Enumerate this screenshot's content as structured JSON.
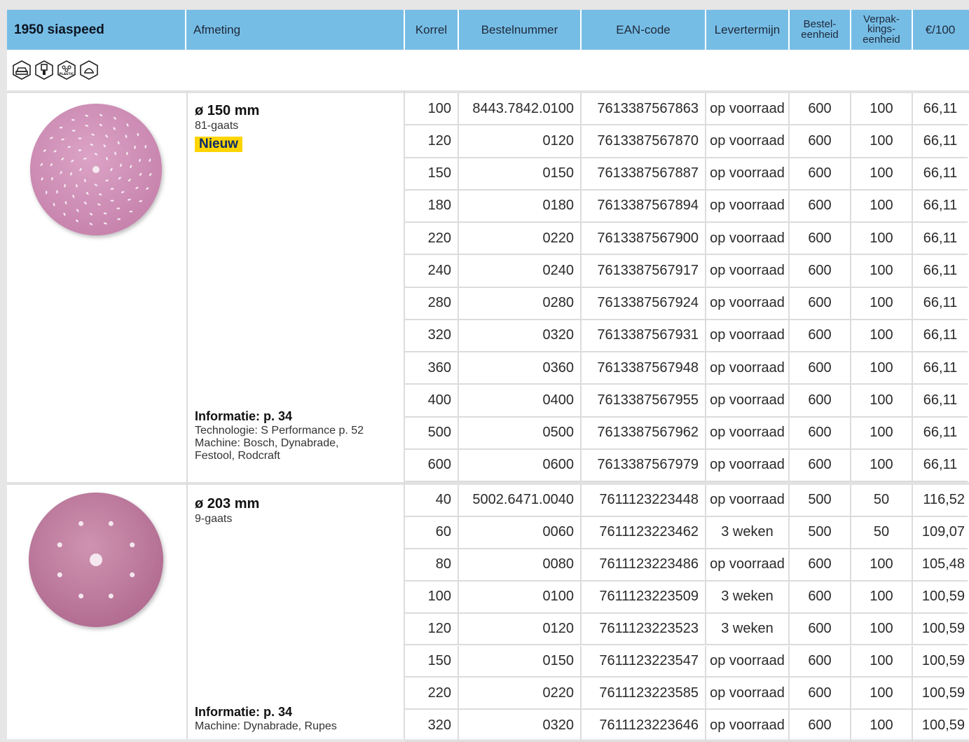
{
  "header": {
    "title": "1950 siaspeed",
    "afmeting": "Afmeting",
    "korrel": "Korrel",
    "bestelnummer": "Bestelnummer",
    "ean": "EAN-code",
    "levertermijn": "Levertermijn",
    "besteleenheid_1": "Bestel-",
    "besteleenheid_2": "eenheid",
    "verpak_1": "Verpak-",
    "verpak_2": "kings-",
    "verpak_3": "eenheid",
    "prijs": "€/100"
  },
  "icons": [
    {
      "name": "car-body-icon"
    },
    {
      "name": "paint-brush-icon"
    },
    {
      "name": "plastic-icon",
      "label": "PLASTIC"
    },
    {
      "name": "filler-icon"
    }
  ],
  "products": [
    {
      "size": "ø 150 mm",
      "holes": "81-gaats",
      "badge": "Nieuw",
      "info": "Informatie: p. 34",
      "notes": [
        "Technologie: S Performance p. 52",
        "Machine: Bosch, Dynabrade,",
        "Festool, Rodcraft"
      ],
      "rows": [
        {
          "korrel": "100",
          "best": "8443.7842.0100",
          "ean": "7613387567863",
          "lever": "op voorraad",
          "be": "600",
          "ve": "100",
          "prijs": "66,11"
        },
        {
          "korrel": "120",
          "best": "0120",
          "ean": "7613387567870",
          "lever": "op voorraad",
          "be": "600",
          "ve": "100",
          "prijs": "66,11"
        },
        {
          "korrel": "150",
          "best": "0150",
          "ean": "7613387567887",
          "lever": "op voorraad",
          "be": "600",
          "ve": "100",
          "prijs": "66,11"
        },
        {
          "korrel": "180",
          "best": "0180",
          "ean": "7613387567894",
          "lever": "op voorraad",
          "be": "600",
          "ve": "100",
          "prijs": "66,11"
        },
        {
          "korrel": "220",
          "best": "0220",
          "ean": "7613387567900",
          "lever": "op voorraad",
          "be": "600",
          "ve": "100",
          "prijs": "66,11"
        },
        {
          "korrel": "240",
          "best": "0240",
          "ean": "7613387567917",
          "lever": "op voorraad",
          "be": "600",
          "ve": "100",
          "prijs": "66,11"
        },
        {
          "korrel": "280",
          "best": "0280",
          "ean": "7613387567924",
          "lever": "op voorraad",
          "be": "600",
          "ve": "100",
          "prijs": "66,11"
        },
        {
          "korrel": "320",
          "best": "0320",
          "ean": "7613387567931",
          "lever": "op voorraad",
          "be": "600",
          "ve": "100",
          "prijs": "66,11"
        },
        {
          "korrel": "360",
          "best": "0360",
          "ean": "7613387567948",
          "lever": "op voorraad",
          "be": "600",
          "ve": "100",
          "prijs": "66,11"
        },
        {
          "korrel": "400",
          "best": "0400",
          "ean": "7613387567955",
          "lever": "op voorraad",
          "be": "600",
          "ve": "100",
          "prijs": "66,11"
        },
        {
          "korrel": "500",
          "best": "0500",
          "ean": "7613387567962",
          "lever": "op voorraad",
          "be": "600",
          "ve": "100",
          "prijs": "66,11"
        },
        {
          "korrel": "600",
          "best": "0600",
          "ean": "7613387567979",
          "lever": "op voorraad",
          "be": "600",
          "ve": "100",
          "prijs": "66,11"
        }
      ]
    },
    {
      "size": "ø 203 mm",
      "holes": "9-gaats",
      "info": "Informatie: p. 34",
      "notes": [
        "Machine: Dynabrade, Rupes"
      ],
      "rows": [
        {
          "korrel": "40",
          "best": "5002.6471.0040",
          "ean": "7611123223448",
          "lever": "op voorraad",
          "be": "500",
          "ve": "50",
          "prijs": "116,52"
        },
        {
          "korrel": "60",
          "best": "0060",
          "ean": "7611123223462",
          "lever": "3 weken",
          "be": "500",
          "ve": "50",
          "prijs": "109,07"
        },
        {
          "korrel": "80",
          "best": "0080",
          "ean": "7611123223486",
          "lever": "op voorraad",
          "be": "600",
          "ve": "100",
          "prijs": "105,48"
        },
        {
          "korrel": "100",
          "best": "0100",
          "ean": "7611123223509",
          "lever": "3 weken",
          "be": "600",
          "ve": "100",
          "prijs": "100,59"
        },
        {
          "korrel": "120",
          "best": "0120",
          "ean": "7611123223523",
          "lever": "3 weken",
          "be": "600",
          "ve": "100",
          "prijs": "100,59"
        },
        {
          "korrel": "150",
          "best": "0150",
          "ean": "7611123223547",
          "lever": "op voorraad",
          "be": "600",
          "ve": "100",
          "prijs": "100,59"
        },
        {
          "korrel": "220",
          "best": "0220",
          "ean": "7611123223585",
          "lever": "op voorraad",
          "be": "600",
          "ve": "100",
          "prijs": "100,59"
        },
        {
          "korrel": "320",
          "best": "0320",
          "ean": "7611123223646",
          "lever": "op voorraad",
          "be": "600",
          "ve": "100",
          "prijs": "100,59"
        }
      ]
    }
  ]
}
